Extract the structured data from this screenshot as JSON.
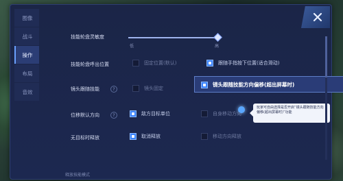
{
  "sidebar": {
    "tabs": [
      {
        "label": "图像",
        "active": false
      },
      {
        "label": "战斗",
        "active": false
      },
      {
        "label": "操作",
        "active": true
      },
      {
        "label": "布局",
        "active": false
      },
      {
        "label": "音效",
        "active": false
      }
    ]
  },
  "settings": {
    "skill_wheel_sensitivity": {
      "label": "技能轮盘灵敏度",
      "value": 1.0,
      "min_label": "低",
      "max_label": "高"
    },
    "skill_wheel_position": {
      "label": "技能轮盘呼出位置",
      "options": [
        {
          "label": "固定位置(默认)",
          "selected": false
        },
        {
          "label": "跟随手指按下位置(适合滑动)",
          "selected": true
        }
      ]
    },
    "camera_follow_skill": {
      "label": "镜头跟随技能",
      "options": [
        {
          "label": "镜头固定",
          "selected": false
        },
        {
          "label": "镜头跟随技能方向偏移(超出屏幕时)",
          "selected": true
        }
      ]
    },
    "move_default_direction": {
      "label": "位移默认方向",
      "options": [
        {
          "label": "敌方目标单位",
          "selected": true
        },
        {
          "label": "自身移动方向",
          "selected": false
        }
      ]
    },
    "no_target_release": {
      "label": "无目标时释放",
      "options": [
        {
          "label": "取消释放",
          "selected": true
        },
        {
          "label": "移动方向释放",
          "selected": false
        }
      ]
    }
  },
  "tooltip": {
    "text": "玩家可自由选择是否开启“镜头跟随技能方向偏移(超出屏幕时)”功能"
  },
  "footer": {
    "text": "释放技能模式"
  },
  "help_icon_glyph": "?",
  "close_icon": "close-x-icon",
  "colors": {
    "accent": "#3a82ff",
    "panel": "#1b2547",
    "active_tab": "#2b3d75"
  }
}
